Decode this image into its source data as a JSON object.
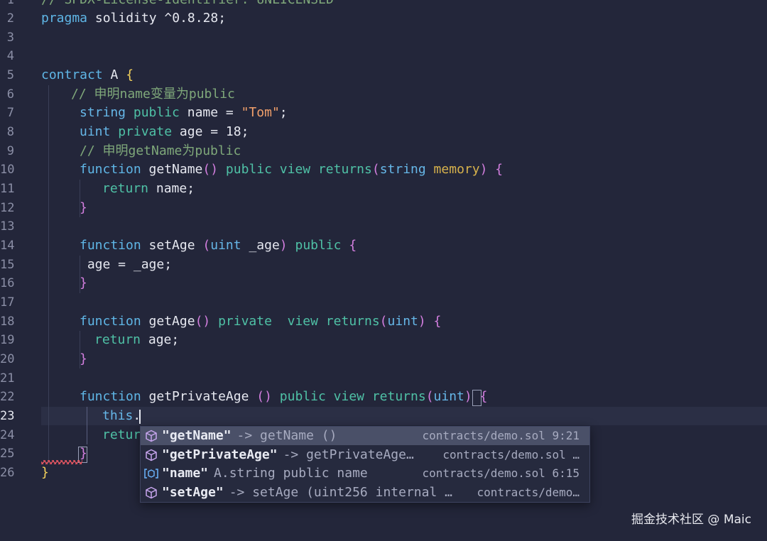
{
  "editor": {
    "line_numbers": [
      "1",
      "2",
      "3",
      "4",
      "5",
      "6",
      "7",
      "8",
      "9",
      "10",
      "11",
      "12",
      "13",
      "14",
      "15",
      "16",
      "17",
      "18",
      "19",
      "20",
      "21",
      "22",
      "23",
      "24",
      "25",
      "26"
    ],
    "lines": {
      "l1": "// SPDX-License-Identifier: UNLICENSED",
      "l2_kw": "pragma",
      "l2_rest": " solidity ^0.8.28;",
      "l5_kw": "contract",
      "l5_name": " A ",
      "l5_brace": "{",
      "l6": "// 申明name变量为public",
      "l7_type": "string",
      "l7_vis": " public",
      "l7_rest": " name = ",
      "l7_str": "\"Tom\"",
      "l7_end": ";",
      "l8_type": "uint",
      "l8_vis": " private",
      "l8_rest": " age = 18;",
      "l9": "// 申明getName为public",
      "l10_kw": "function",
      "l10_name": " getName",
      "l10_paren": "()",
      "l10_mods": " public view returns",
      "l10_paren2o": "(",
      "l10_type": "string",
      "l10_mem": " memory",
      "l10_paren2c": ")",
      "l10_brace": " {",
      "l11_kw": "return",
      "l11_rest": " name;",
      "l12": "}",
      "l14_kw": "function",
      "l14_name": " setAge ",
      "l14_po": "(",
      "l14_type": "uint",
      "l14_arg": " _age",
      "l14_pc": ")",
      "l14_vis": " public",
      "l14_brace": " {",
      "l15": " age = _age;",
      "l16": "}",
      "l18_kw": "function",
      "l18_name": " getAge",
      "l18_paren": "()",
      "l18_mods": " private  view returns",
      "l18_po": "(",
      "l18_type": "uint",
      "l18_pc": ")",
      "l18_brace": " {",
      "l19_kw": "return",
      "l19_rest": " age;",
      "l20": "}",
      "l22_kw": "function",
      "l22_name": " getPrivateAge ",
      "l22_paren": "()",
      "l22_mods": " public view returns",
      "l22_po": "(",
      "l22_type": "uint",
      "l22_pc": ")",
      "l22_brace": "{",
      "l23_this": "this",
      "l23_dot": ".",
      "l24": "retur",
      "l25": "}",
      "l26": "}"
    }
  },
  "suggestions": [
    {
      "label": "\"getName\"",
      "detail": "-> getName ()",
      "file": "contracts/demo.sol 9:21",
      "icon": "cube-icon",
      "selected": true
    },
    {
      "label": "\"getPrivateAge\"",
      "detail": "-> getPrivateAge…",
      "file": "contracts/demo.sol …",
      "icon": "cube-icon",
      "selected": false
    },
    {
      "label": "\"name\"",
      "detail": "A.string public name",
      "file": "contracts/demo.sol 6:15",
      "icon": "variable-icon",
      "selected": false
    },
    {
      "label": "\"setAge\"",
      "detail": "-> setAge (uint256 internal …",
      "file": "contracts/demo…",
      "icon": "cube-icon",
      "selected": false
    }
  ],
  "watermark": "掘金技术社区 @ Maic",
  "colors": {
    "background": "#23263a",
    "suggest_selected": "#4a5068",
    "error_squiggle": "#e05561"
  }
}
